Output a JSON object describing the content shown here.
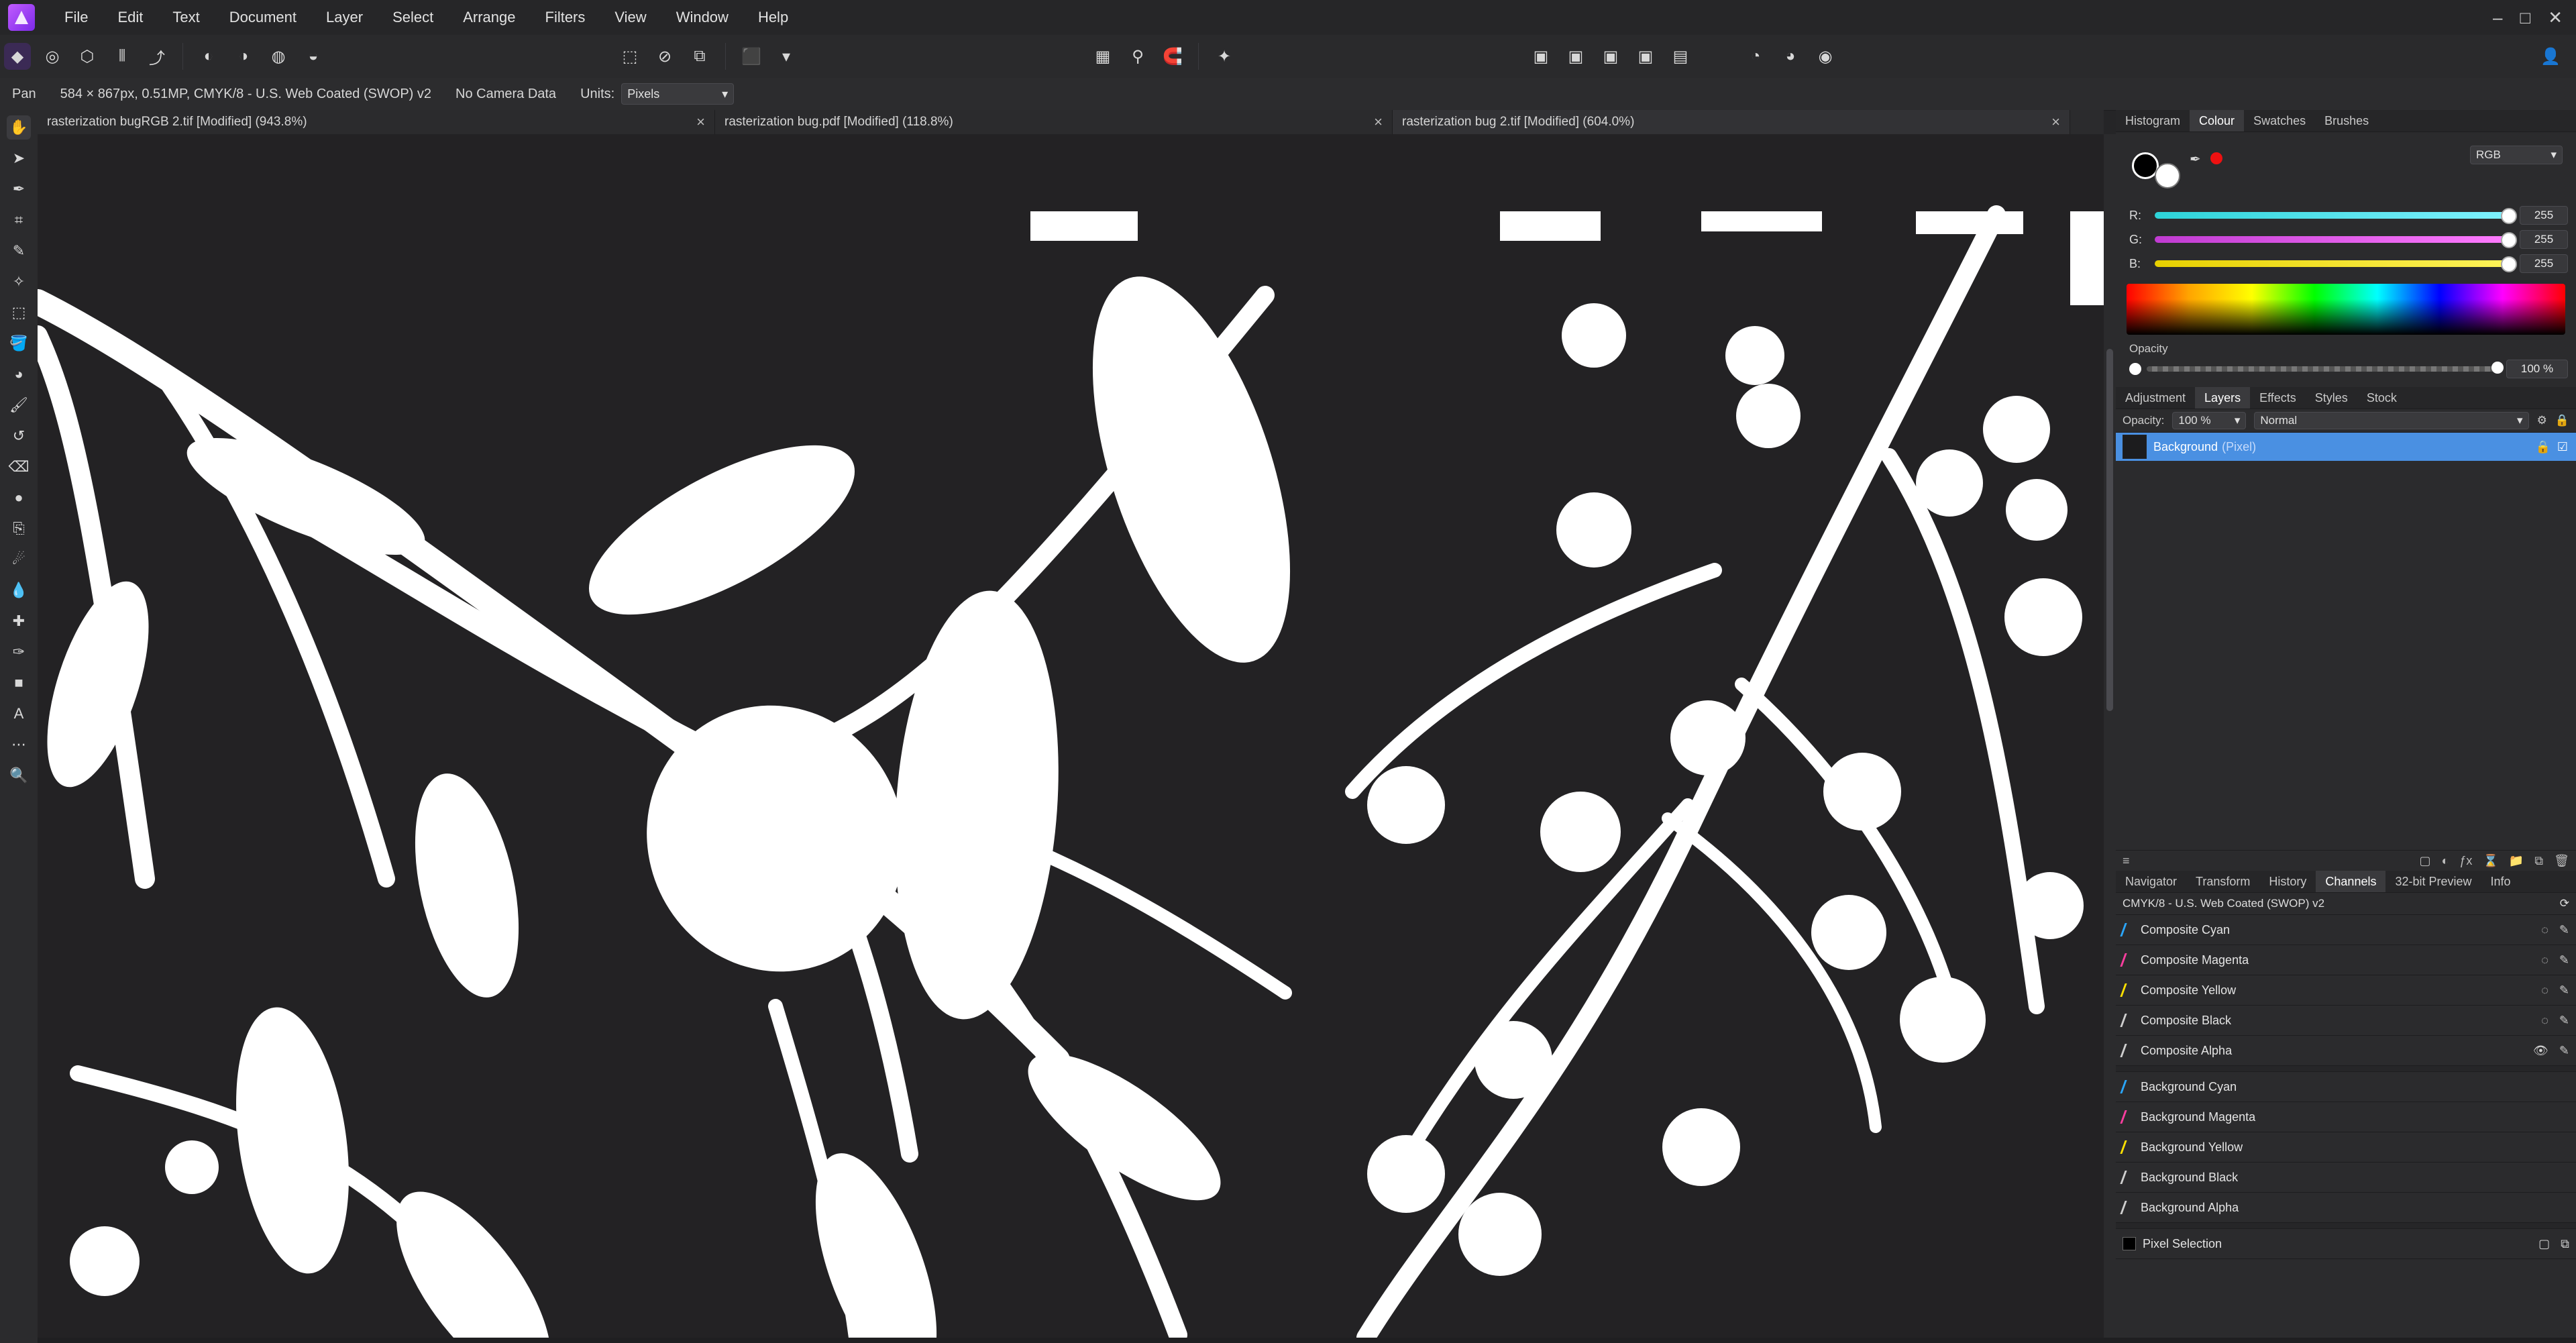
{
  "app": {
    "menu": [
      "File",
      "Edit",
      "Text",
      "Document",
      "Layer",
      "Select",
      "Arrange",
      "Filters",
      "View",
      "Window",
      "Help"
    ],
    "win_controls": [
      "–",
      "□",
      "✕"
    ]
  },
  "toolbar": {
    "icons": [
      "persona-photo-icon",
      "persona-liquify-icon",
      "persona-develop-icon",
      "persona-tone-map-icon",
      "persona-export-icon",
      "colour-wheel-icon",
      "contrast-icon",
      "rgb-circles-icon",
      "white-balance-icon",
      "marquee-icon",
      "no-selection-icon",
      "invert-selection-icon",
      "quick-mask-icon",
      "dropdown-icon",
      "grid-icon",
      "snapping-icon",
      "assistant-icon",
      "alignment-icon",
      "arrange-1-icon",
      "arrange-2-icon",
      "arrange-3-icon",
      "arrange-4-icon",
      "arrange-5-icon",
      "persona-1-icon",
      "persona-2-icon",
      "persona-3-icon",
      "user-icon"
    ]
  },
  "context": {
    "tool": "Pan",
    "doc_info": "584 × 867px, 0.51MP, CMYK/8 - U.S. Web Coated (SWOP) v2",
    "camera": "No Camera Data",
    "units_label": "Units:",
    "units_value": "Pixels"
  },
  "tabs": [
    {
      "label": "rasterization bugRGB 2.tif [Modified] (943.8%)",
      "active": false
    },
    {
      "label": "rasterization bug.pdf [Modified] (118.8%)",
      "active": false
    },
    {
      "label": "rasterization bug 2.tif [Modified] (604.0%)",
      "active": true
    }
  ],
  "right": {
    "colour_tabs": [
      "Histogram",
      "Colour",
      "Swatches",
      "Brushes"
    ],
    "colour": {
      "mode": "RGB",
      "R": "255",
      "G": "255",
      "B": "255",
      "opacity_label": "Opacity",
      "opacity_value": "100 %",
      "colors": {
        "r": "#ff4b4b",
        "g": "#20d060",
        "b": "#3a8cff"
      }
    },
    "layer_tabs": [
      "Adjustment",
      "Layers",
      "Effects",
      "Styles",
      "Stock"
    ],
    "layers": {
      "opacity_label": "Opacity:",
      "opacity_value": "100 %",
      "blend": "Normal",
      "rows": [
        {
          "name": "Background",
          "type": "(Pixel)"
        }
      ]
    },
    "bottom_tabs": [
      "Navigator",
      "Transform",
      "History",
      "Channels",
      "32-bit Preview",
      "Info"
    ],
    "channels": {
      "profile": "CMYK/8 - U.S. Web Coated (SWOP) v2",
      "composite": [
        "Composite Cyan",
        "Composite Magenta",
        "Composite Yellow",
        "Composite Black",
        "Composite Alpha"
      ],
      "background": [
        "Background Cyan",
        "Background Magenta",
        "Background Yellow",
        "Background Black",
        "Background Alpha"
      ],
      "pixel": "Pixel Selection"
    }
  }
}
